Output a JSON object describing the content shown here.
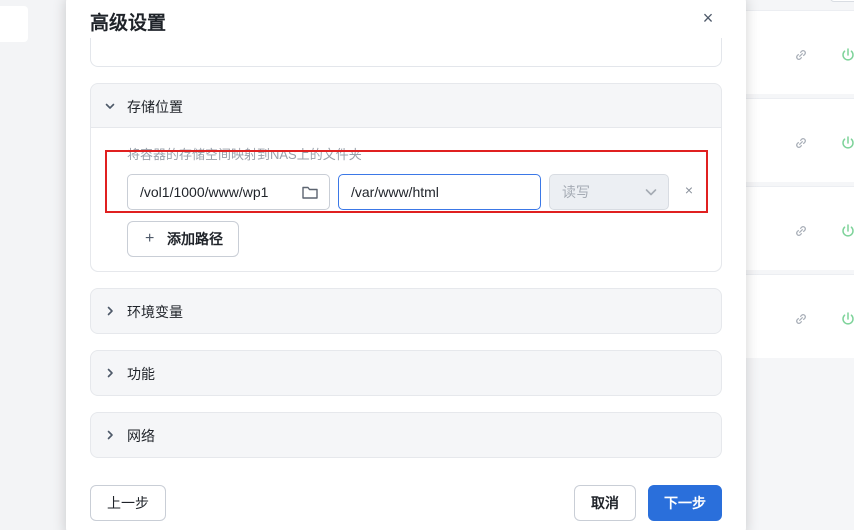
{
  "modal": {
    "title": "高级设置",
    "close_label": "×"
  },
  "panels": {
    "storage": {
      "title": "存储位置",
      "expanded": true,
      "hint": "将容器的存储空间映射到NAS上的文件夹",
      "mapping": {
        "host_path": "/vol1/1000/www/wp1",
        "container_path": "/var/www/html",
        "permission": "读写",
        "remove_label": "×"
      },
      "add_path_label": "添加路径",
      "add_path_plus": "+"
    },
    "env": {
      "title": "环境变量",
      "expanded": false
    },
    "func": {
      "title": "功能",
      "expanded": false
    },
    "net": {
      "title": "网络",
      "expanded": false
    }
  },
  "footer": {
    "prev_label": "上一步",
    "cancel_label": "取消",
    "next_label": "下一步"
  },
  "icons": {
    "chevron_down": "chevron-down-icon",
    "chevron_right": "chevron-right-icon",
    "folder": "folder-icon",
    "dropdown": "dropdown-arrow-icon",
    "link": "link-icon",
    "power": "power-icon"
  },
  "colors": {
    "primary": "#2a6fdb",
    "highlight_border": "#e02020",
    "focus_border": "#3b78e7",
    "power_green": "#7ed39a"
  }
}
